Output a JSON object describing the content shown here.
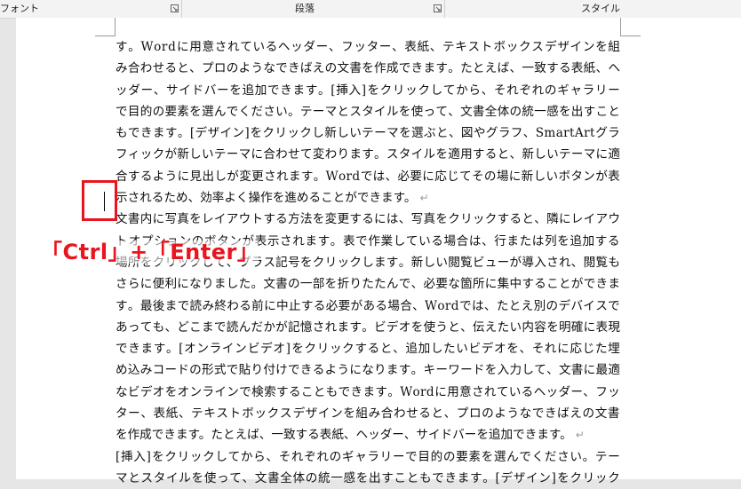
{
  "ribbon": {
    "groups": [
      {
        "label": "フォント"
      },
      {
        "label": "段落"
      },
      {
        "label": "スタイル"
      }
    ]
  },
  "document": {
    "lines": [
      {
        "text": "す。Word に用意されているヘッダー、フッター、表紙、テキスト ボックス デザインを組"
      },
      {
        "text": "み合わせると、プロのようなできばえの文書を作成できます。たとえば、一致する表紙、ヘ"
      },
      {
        "text": "ッダー、サイドバーを追加できます。[挿入] をクリックしてから、それぞれのギャラリー"
      },
      {
        "text": "で目的の要素を選んでください。テーマとスタイルを使って、文書全体の統一感を出すこと"
      },
      {
        "text": "もできます。[デザイン] をクリックし新しいテーマを選ぶと、図やグラフ、SmartArt グラ"
      },
      {
        "text": "フィックが新しいテーマに合わせて変わります。スタイルを適用すると、新しいテーマに適"
      },
      {
        "text": "合するように見出しが変更されます。Word では、必要に応じてその場に新しいボタンが表"
      },
      {
        "text": "示されるため、効率よく操作を進めることができます。",
        "para_end": true
      },
      {
        "text": "文書内に写真をレイアウトする方法を変更するには、写真をクリックすると、隣にレイアウ"
      },
      {
        "text": "ト オプションのボタンが表示されます。表で作業している場合は、行または列を追加する"
      },
      {
        "text": "場所をクリックして、プラス記号をクリックします。新しい閲覧ビューが導入され、閲覧も"
      },
      {
        "text": "さらに便利になりました。文書の一部を折りたたんで、必要な箇所に集中することができま"
      },
      {
        "text": "す。最後まで読み終わる前に中止する必要がある場合、Word では、たとえ別のデバイスで"
      },
      {
        "text": "あっても、どこまで読んだかが記憶されます。ビデオを使うと、伝えたい内容を明確に表現"
      },
      {
        "text": "できます。[オンライン ビデオ] をクリックすると、追加したいビデオを、それに応じた埋"
      },
      {
        "text": "め込みコードの形式で貼り付けできるようになります。キーワードを入力して、文書に最適"
      },
      {
        "text": "なビデオをオンラインで検索することもできます。Word に用意されているヘッダー、フッ"
      },
      {
        "text": "ター、表紙、テキスト ボックス デザインを組み合わせると、プロのようなできばえの文書"
      },
      {
        "text": "を作成できます。たとえば、一致する表紙、ヘッダー、サイドバーを追加できます。",
        "para_end": true
      },
      {
        "text": "[挿入] をクリックしてから、それぞれのギャラリーで目的の要素を選んでください。テー"
      },
      {
        "text": "マとスタイルを使って、文書全体の統一感を出すこともできます。[デザイン] をクリック"
      }
    ],
    "pilcrow": "↵"
  },
  "annotation": {
    "callout": "「Ctrl」+「Enter」",
    "color": "#e8141e"
  }
}
